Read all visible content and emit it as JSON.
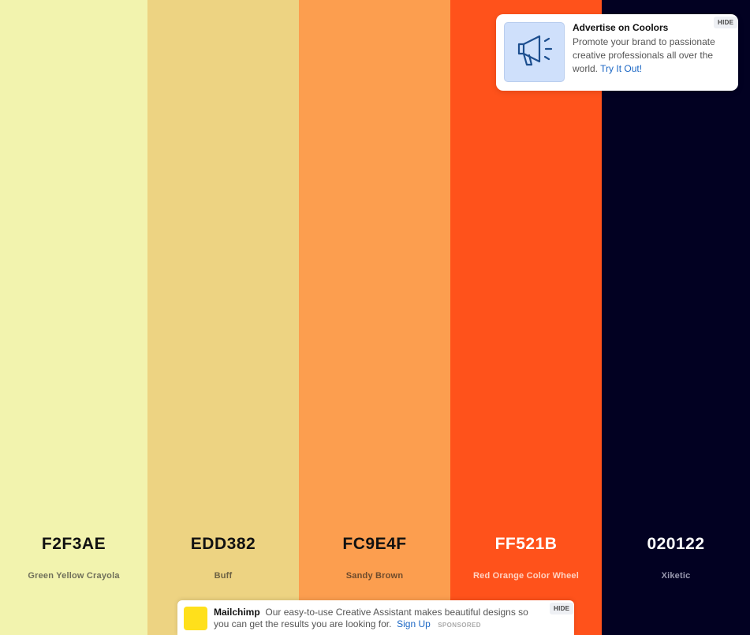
{
  "palette": [
    {
      "hex": "F2F3AE",
      "name": "Green Yellow Crayola",
      "color": "#F2F3AE",
      "hex_color": "#111111",
      "name_color": "#6f6f5a",
      "width": 187
    },
    {
      "hex": "EDD382",
      "name": "Buff",
      "color": "#EDD382",
      "hex_color": "#111111",
      "name_color": "#6d6244",
      "width": 192
    },
    {
      "hex": "FC9E4F",
      "name": "Sandy Brown",
      "color": "#FC9E4F",
      "hex_color": "#111111",
      "name_color": "#6e4b2c",
      "width": 192
    },
    {
      "hex": "FF521B",
      "name": "Red Orange Color Wheel",
      "color": "#FF521B",
      "hex_color": "#ffffff",
      "name_color": "#ffd2c2",
      "width": 192
    },
    {
      "hex": "020122",
      "name": "Xiketic",
      "color": "#020122",
      "hex_color": "#ffffff",
      "name_color": "#9a9ab0",
      "width": 188
    }
  ],
  "ad_card": {
    "title": "Advertise on Coolors",
    "body": "Promote your brand to passionate creative professionals all over the world.",
    "link": "Try It Out!",
    "hide": "HIDE",
    "icon": "megaphone-icon"
  },
  "ad_bar": {
    "brand": "Mailchimp",
    "text": "Our easy-to-use Creative Assistant makes beautiful designs so you can get the results you are looking for.",
    "link": "Sign Up",
    "sponsored": "SPONSORED",
    "hide": "HIDE",
    "logo_color": "#FFE01B"
  }
}
